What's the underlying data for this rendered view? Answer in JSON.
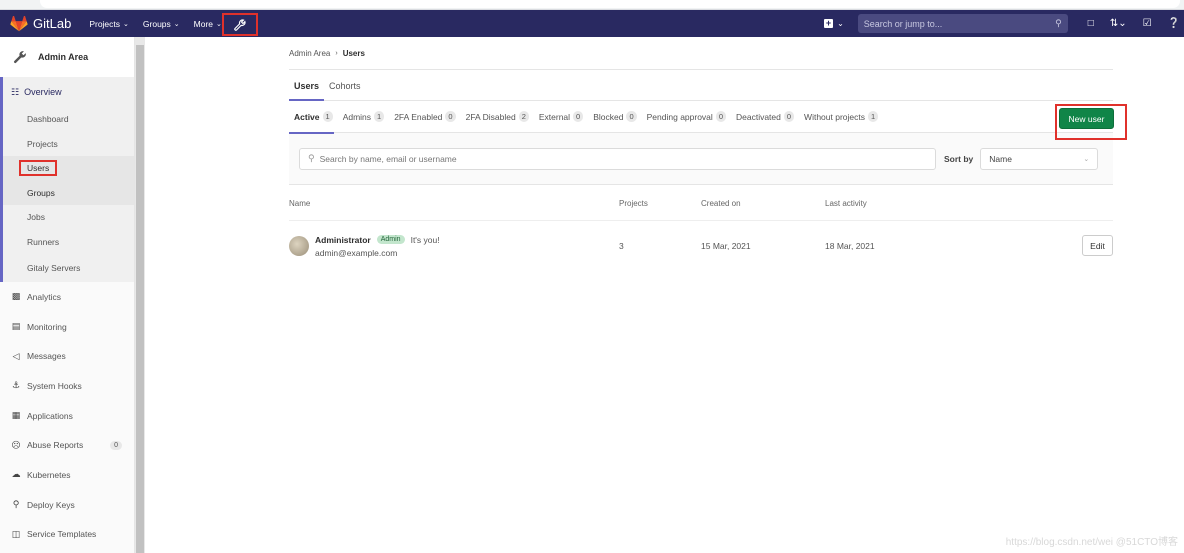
{
  "navbar": {
    "brand": "GitLab",
    "items": [
      {
        "label": "Projects",
        "icon": "chevron-down-icon"
      },
      {
        "label": "Groups",
        "icon": "chevron-down-icon"
      },
      {
        "label": "More",
        "icon": "chevron-down-icon"
      }
    ],
    "admin_icon": "wrench-icon",
    "search_placeholder": "Search or jump to...",
    "right_icons": [
      "plus-square-icon",
      "issues-icon",
      "merge-request-icon",
      "todo-icon",
      "help-icon"
    ]
  },
  "sidebar": {
    "header": "Admin Area",
    "overview": "Overview",
    "overview_items": [
      "Dashboard",
      "Projects",
      "Users",
      "Groups",
      "Jobs",
      "Runners",
      "Gitaly Servers"
    ],
    "items": [
      {
        "label": "Analytics",
        "icon": "chart-icon"
      },
      {
        "label": "Monitoring",
        "icon": "monitor-icon"
      },
      {
        "label": "Messages",
        "icon": "megaphone-icon"
      },
      {
        "label": "System Hooks",
        "icon": "anchor-icon"
      },
      {
        "label": "Applications",
        "icon": "grid-icon"
      },
      {
        "label": "Abuse Reports",
        "icon": "frown-icon",
        "badge": "0"
      },
      {
        "label": "Kubernetes",
        "icon": "cloud-icon"
      },
      {
        "label": "Deploy Keys",
        "icon": "key-icon"
      },
      {
        "label": "Service Templates",
        "icon": "template-icon"
      }
    ]
  },
  "breadcrumb": {
    "parent": "Admin Area",
    "current": "Users"
  },
  "top_tabs": [
    "Users",
    "Cohorts"
  ],
  "filters": [
    {
      "label": "Active",
      "count": "1"
    },
    {
      "label": "Admins",
      "count": "1"
    },
    {
      "label": "2FA Enabled",
      "count": "0"
    },
    {
      "label": "2FA Disabled",
      "count": "2"
    },
    {
      "label": "External",
      "count": "0"
    },
    {
      "label": "Blocked",
      "count": "0"
    },
    {
      "label": "Pending approval",
      "count": "0"
    },
    {
      "label": "Deactivated",
      "count": "0"
    },
    {
      "label": "Without projects",
      "count": "1"
    }
  ],
  "new_user_label": "New user",
  "search": {
    "placeholder": "Search by name, email or username"
  },
  "sort": {
    "label": "Sort by",
    "value": "Name"
  },
  "table": {
    "headers": [
      "Name",
      "Projects",
      "Created on",
      "Last activity"
    ],
    "rows": [
      {
        "name": "Administrator",
        "badge": "Admin",
        "note": "It's you!",
        "email": "admin@example.com",
        "projects": "3",
        "created_on": "15 Mar, 2021",
        "last_activity": "18 Mar, 2021",
        "action": "Edit"
      }
    ]
  },
  "watermark": "https://blog.csdn.net/wei @51CTO博客",
  "colors": {
    "navbar": "#292961",
    "accent": "#6666c4",
    "primary_button": "#108548",
    "highlight_box": "#e0312b"
  }
}
